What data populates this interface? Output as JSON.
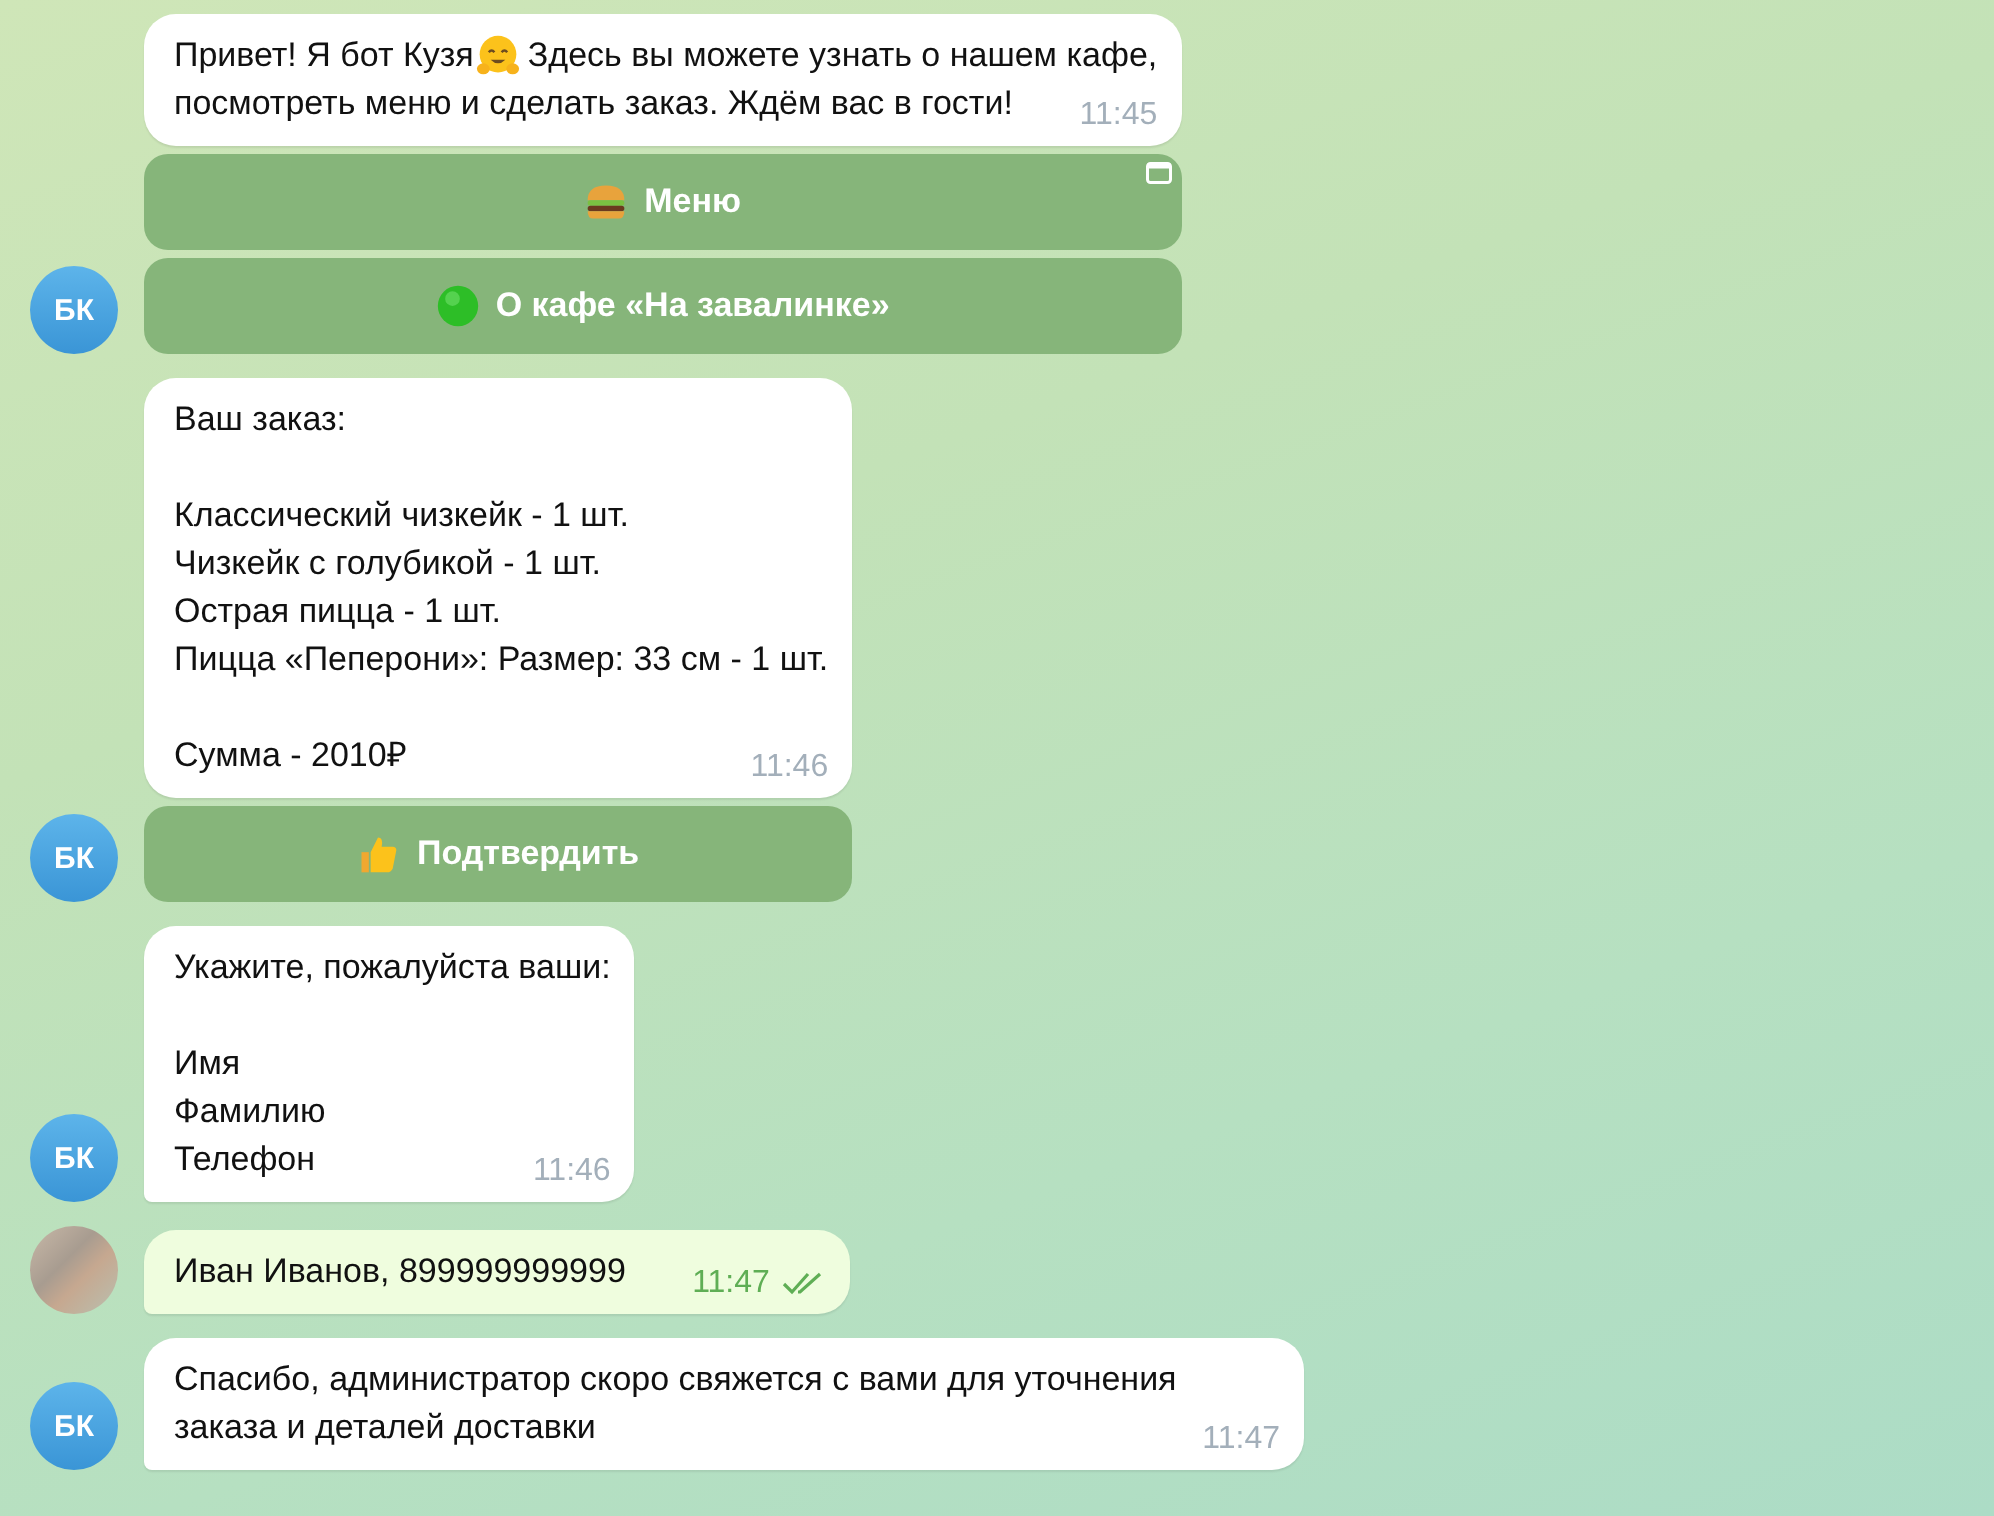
{
  "groups": [
    {
      "kind": "incoming",
      "avatar": "БК",
      "messages": [
        {
          "intro": [
            "Привет! Я бот Кузя",
            "Здесь вы можете узнать о нашем кафе,"
          ],
          "paragraphs": [
            "посмотреть меню и сделать заказ. Ждём вас в гости!"
          ],
          "time": "11:45",
          "buttons": [
            {
              "label": "Меню",
              "web_app": true
            },
            {
              "label": "О кафе «На завалинке»",
              "web_app": false
            }
          ]
        }
      ]
    },
    {
      "kind": "incoming",
      "avatar": "БК",
      "messages": [
        {
          "paragraphs": [
            "Ваш заказ:",
            "Классический чизкейк - 1 шт.\nЧизкейк с голубикой - 1 шт.\nОстрая пицца - 1 шт.\nПицца «Пеперони»: Размер: 33 см - 1 шт.",
            "Сумма - 2010₽"
          ],
          "time": "11:46",
          "buttons": [
            {
              "label": "Подтвердить",
              "web_app": false
            }
          ]
        }
      ]
    },
    {
      "kind": "incoming",
      "avatar": "БК",
      "messages": [
        {
          "paragraphs": [
            "Укажите, пожалуйста ваши:",
            "Имя\nФамилию\nТелефон"
          ],
          "time": "11:46"
        }
      ]
    },
    {
      "kind": "outgoing",
      "messages": [
        {
          "paragraphs": [
            "Иван Иванов, 899999999999"
          ],
          "time": "11:47",
          "read": true
        }
      ]
    },
    {
      "kind": "incoming",
      "avatar": "БК",
      "messages": [
        {
          "paragraphs": [
            "Спасибо, администратор скоро свяжется с вами для уточнения заказа и деталей доставки"
          ],
          "time": "11:47"
        }
      ]
    }
  ]
}
